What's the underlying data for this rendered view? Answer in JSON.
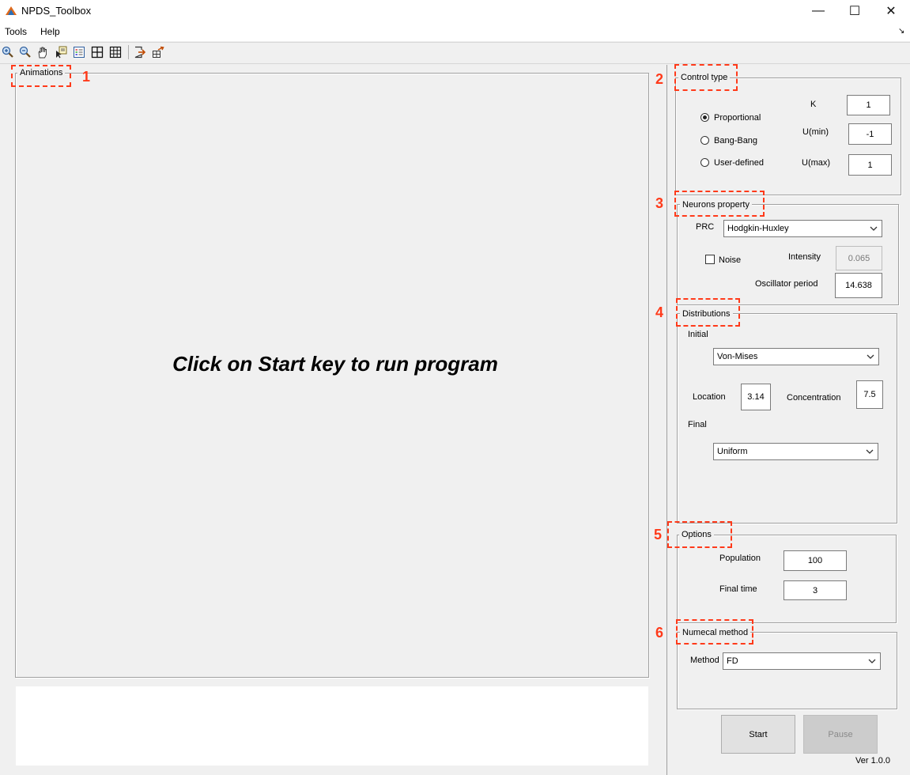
{
  "window": {
    "title": "NPDS_Toolbox",
    "minimize": "—",
    "maximize": "☐",
    "close": "✕"
  },
  "menu": {
    "items": [
      "Tools",
      "Help"
    ],
    "dock_arrow": "↘"
  },
  "toolbar": {
    "icons": [
      "zoom-in-icon",
      "zoom-out-icon",
      "pan-hand-icon",
      "data-cursor-icon",
      "insert-legend-icon",
      "grid-icon",
      "fine-grid-icon",
      "export-icon",
      "dock-figure-icon"
    ]
  },
  "animations": {
    "legend": "Animations",
    "marker": "1",
    "message": "Click on Start key to run program"
  },
  "control_type": {
    "legend": "Control type",
    "marker": "2",
    "options": [
      "Proportional",
      "Bang-Bang",
      "User-defined"
    ],
    "selected": "Proportional",
    "k_label": "K",
    "k_value": "1",
    "umin_label": "U(min)",
    "umin_value": "-1",
    "umax_label": "U(max)",
    "umax_value": "1"
  },
  "neurons": {
    "legend": "Neurons property",
    "marker": "3",
    "prc_label": "PRC",
    "prc_value": "Hodgkin-Huxley",
    "noise_label": "Noise",
    "intensity_label": "Intensity",
    "intensity_value": "0.065",
    "period_label": "Oscillator period",
    "period_value": "14.638"
  },
  "distributions": {
    "legend": "Distributions",
    "marker": "4",
    "initial_label": "Initial",
    "initial_value": "Von-Mises",
    "location_label": "Location",
    "location_value": "3.14",
    "concentration_label": "Concentration",
    "concentration_value": "7.5",
    "final_label": "Final",
    "final_value": "Uniform"
  },
  "options": {
    "legend": "Options",
    "marker": "5",
    "population_label": "Population",
    "population_value": "100",
    "final_time_label": "Final time",
    "final_time_value": "3"
  },
  "numerical": {
    "legend": "Numecal method",
    "marker": "6",
    "method_label": "Method",
    "method_value": "FD"
  },
  "actions": {
    "start": "Start",
    "pause": "Pause"
  },
  "version": "Ver 1.0.0"
}
